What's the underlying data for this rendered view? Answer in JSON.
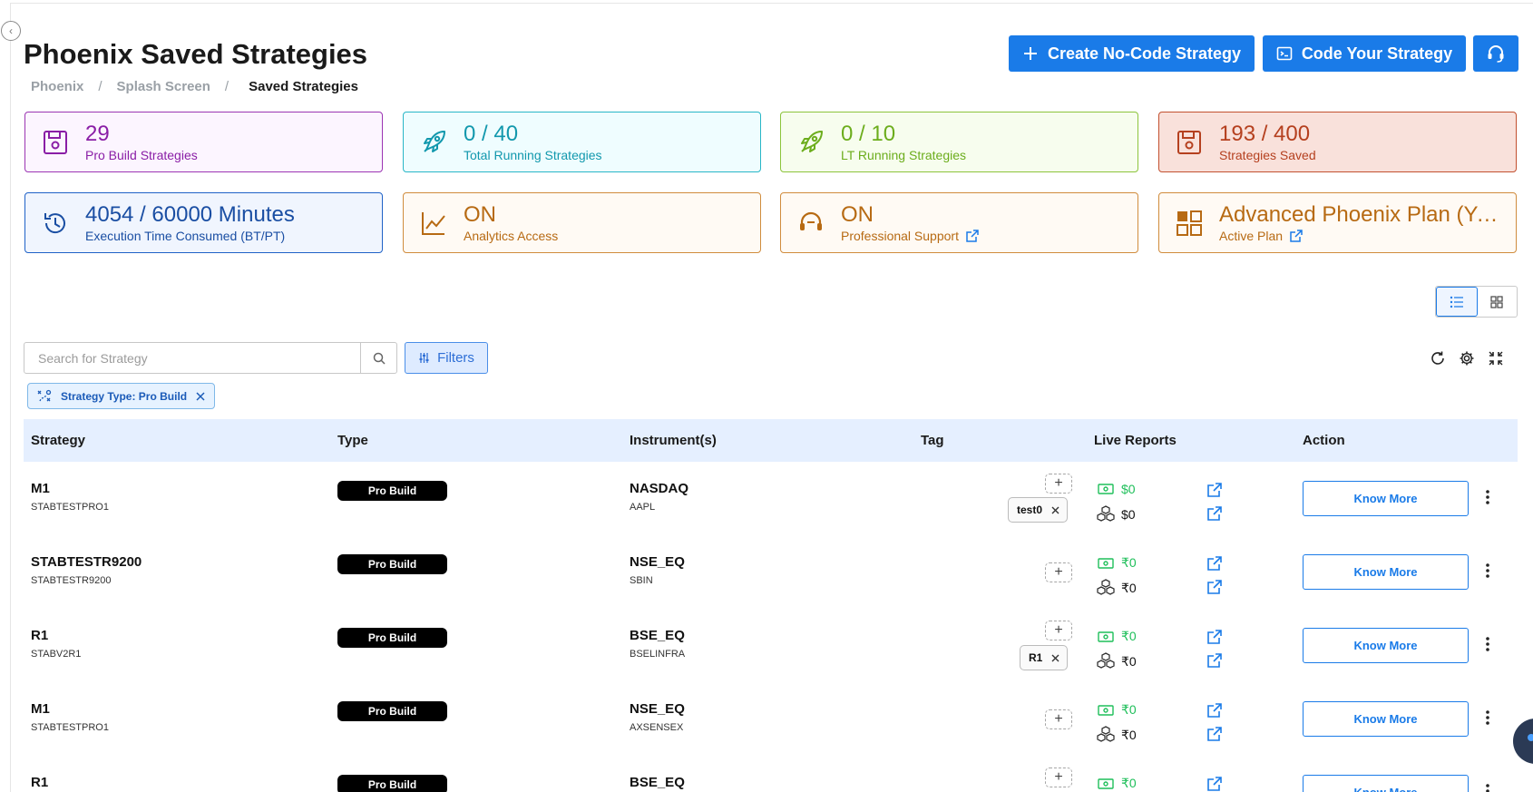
{
  "header": {
    "title": "Phoenix Saved Strategies",
    "breadcrumb": [
      "Phoenix",
      "Splash Screen",
      "Saved Strategies"
    ],
    "breadcrumb_sep": "/",
    "create_nocode_label": "Create No-Code Strategy",
    "code_strategy_label": "Code Your Strategy"
  },
  "stats": [
    {
      "value": "29",
      "label": "Pro Build Strategies",
      "icon": "floppy-icon",
      "color": "#8a1ea6"
    },
    {
      "value": "0 / 40",
      "label": "Total Running Strategies",
      "icon": "rocket-icon",
      "color": "#1298ad"
    },
    {
      "value": "0 / 10",
      "label": "LT Running Strategies",
      "icon": "rocket-icon",
      "color": "#6cad1c"
    },
    {
      "value": "193 / 400",
      "label": "Strategies Saved",
      "icon": "floppy-icon",
      "color": "#b5401f"
    },
    {
      "value": "4054 / 60000 Minutes",
      "label": "Execution Time Consumed (BT/PT)",
      "icon": "history-icon",
      "color": "#1a4ea3"
    },
    {
      "value": "ON",
      "label": "Analytics Access",
      "icon": "line-chart-icon",
      "color": "#b76a13"
    },
    {
      "value": "ON",
      "label": "Professional Support",
      "icon": "headset-icon",
      "color": "#b76a13"
    },
    {
      "value": "Advanced Phoenix Plan (Yearly)",
      "label": "Active Plan",
      "icon": "apps-icon",
      "color": "#b76a13"
    }
  ],
  "search": {
    "placeholder": "Search for Strategy",
    "value": ""
  },
  "filters_label": "Filters",
  "active_filter": "Strategy Type: Pro Build",
  "table": {
    "columns": [
      "Strategy",
      "Type",
      "Instrument(s)",
      "Tag",
      "Live Reports",
      "Action"
    ],
    "rows": [
      {
        "name": "M1",
        "code": "STABTESTPRO1",
        "type": "Pro Build",
        "instrument": "NASDAQ",
        "symbol": "AAPL",
        "tag": "test0",
        "live": "$0",
        "other": "$0",
        "action": "Know More"
      },
      {
        "name": "STABTESTR9200",
        "code": "STABTESTR9200",
        "type": "Pro Build",
        "instrument": "NSE_EQ",
        "symbol": "SBIN",
        "tag": "",
        "live": "₹0",
        "other": "₹0",
        "action": "Know More"
      },
      {
        "name": "R1",
        "code": "STABV2R1",
        "type": "Pro Build",
        "instrument": "BSE_EQ",
        "symbol": "BSELINFRA",
        "tag": "R1",
        "live": "₹0",
        "other": "₹0",
        "action": "Know More"
      },
      {
        "name": "M1",
        "code": "STABTESTPRO1",
        "type": "Pro Build",
        "instrument": "NSE_EQ",
        "symbol": "AXSENSEX",
        "tag": "",
        "live": "₹0",
        "other": "₹0",
        "action": "Know More"
      },
      {
        "name": "R1",
        "code": "",
        "type": "Pro Build",
        "instrument": "BSE_EQ",
        "symbol": "",
        "tag": "",
        "live": "₹0",
        "other": "",
        "action": "Know More"
      }
    ]
  },
  "colors": {
    "accent": "#1a7be8",
    "header_bg": "#e5efff",
    "live_green": "#1fbf5a"
  }
}
